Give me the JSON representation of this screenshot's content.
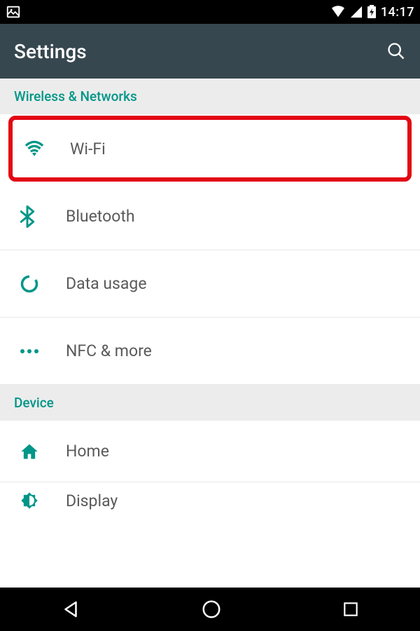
{
  "status": {
    "time": "14:17"
  },
  "header": {
    "title": "Settings"
  },
  "sections": {
    "wireless": {
      "title": "Wireless & Networks",
      "items": {
        "wifi": "Wi-Fi",
        "bluetooth": "Bluetooth",
        "data_usage": "Data usage",
        "nfc_more": "NFC & more"
      }
    },
    "device": {
      "title": "Device",
      "items": {
        "home": "Home",
        "display": "Display"
      }
    }
  },
  "colors": {
    "accent": "#009688",
    "highlight": "#E30613",
    "appbar": "#37474F"
  }
}
